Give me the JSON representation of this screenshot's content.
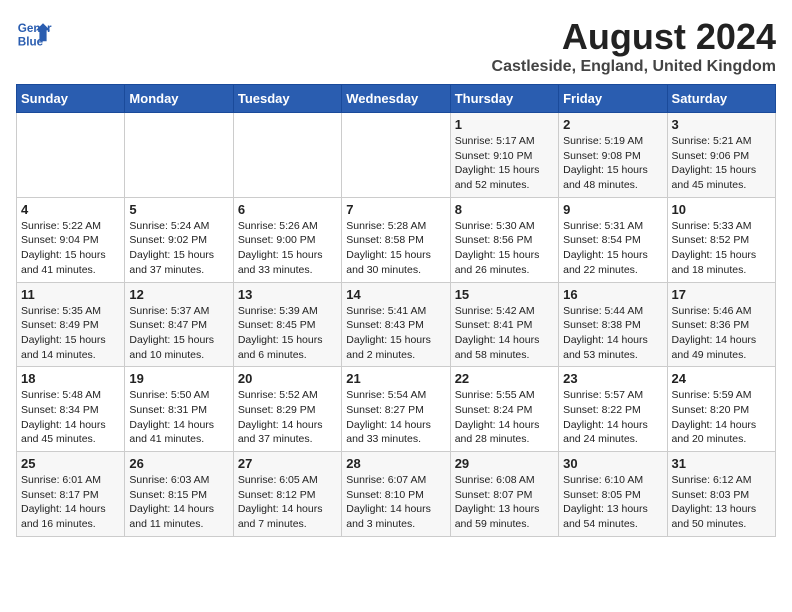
{
  "logo": {
    "line1": "General",
    "line2": "Blue"
  },
  "title": "August 2024",
  "subtitle": "Castleside, England, United Kingdom",
  "days_of_week": [
    "Sunday",
    "Monday",
    "Tuesday",
    "Wednesday",
    "Thursday",
    "Friday",
    "Saturday"
  ],
  "weeks": [
    [
      {
        "day": "",
        "info": ""
      },
      {
        "day": "",
        "info": ""
      },
      {
        "day": "",
        "info": ""
      },
      {
        "day": "",
        "info": ""
      },
      {
        "day": "1",
        "info": "Sunrise: 5:17 AM\nSunset: 9:10 PM\nDaylight: 15 hours\nand 52 minutes."
      },
      {
        "day": "2",
        "info": "Sunrise: 5:19 AM\nSunset: 9:08 PM\nDaylight: 15 hours\nand 48 minutes."
      },
      {
        "day": "3",
        "info": "Sunrise: 5:21 AM\nSunset: 9:06 PM\nDaylight: 15 hours\nand 45 minutes."
      }
    ],
    [
      {
        "day": "4",
        "info": "Sunrise: 5:22 AM\nSunset: 9:04 PM\nDaylight: 15 hours\nand 41 minutes."
      },
      {
        "day": "5",
        "info": "Sunrise: 5:24 AM\nSunset: 9:02 PM\nDaylight: 15 hours\nand 37 minutes."
      },
      {
        "day": "6",
        "info": "Sunrise: 5:26 AM\nSunset: 9:00 PM\nDaylight: 15 hours\nand 33 minutes."
      },
      {
        "day": "7",
        "info": "Sunrise: 5:28 AM\nSunset: 8:58 PM\nDaylight: 15 hours\nand 30 minutes."
      },
      {
        "day": "8",
        "info": "Sunrise: 5:30 AM\nSunset: 8:56 PM\nDaylight: 15 hours\nand 26 minutes."
      },
      {
        "day": "9",
        "info": "Sunrise: 5:31 AM\nSunset: 8:54 PM\nDaylight: 15 hours\nand 22 minutes."
      },
      {
        "day": "10",
        "info": "Sunrise: 5:33 AM\nSunset: 8:52 PM\nDaylight: 15 hours\nand 18 minutes."
      }
    ],
    [
      {
        "day": "11",
        "info": "Sunrise: 5:35 AM\nSunset: 8:49 PM\nDaylight: 15 hours\nand 14 minutes."
      },
      {
        "day": "12",
        "info": "Sunrise: 5:37 AM\nSunset: 8:47 PM\nDaylight: 15 hours\nand 10 minutes."
      },
      {
        "day": "13",
        "info": "Sunrise: 5:39 AM\nSunset: 8:45 PM\nDaylight: 15 hours\nand 6 minutes."
      },
      {
        "day": "14",
        "info": "Sunrise: 5:41 AM\nSunset: 8:43 PM\nDaylight: 15 hours\nand 2 minutes."
      },
      {
        "day": "15",
        "info": "Sunrise: 5:42 AM\nSunset: 8:41 PM\nDaylight: 14 hours\nand 58 minutes."
      },
      {
        "day": "16",
        "info": "Sunrise: 5:44 AM\nSunset: 8:38 PM\nDaylight: 14 hours\nand 53 minutes."
      },
      {
        "day": "17",
        "info": "Sunrise: 5:46 AM\nSunset: 8:36 PM\nDaylight: 14 hours\nand 49 minutes."
      }
    ],
    [
      {
        "day": "18",
        "info": "Sunrise: 5:48 AM\nSunset: 8:34 PM\nDaylight: 14 hours\nand 45 minutes."
      },
      {
        "day": "19",
        "info": "Sunrise: 5:50 AM\nSunset: 8:31 PM\nDaylight: 14 hours\nand 41 minutes."
      },
      {
        "day": "20",
        "info": "Sunrise: 5:52 AM\nSunset: 8:29 PM\nDaylight: 14 hours\nand 37 minutes."
      },
      {
        "day": "21",
        "info": "Sunrise: 5:54 AM\nSunset: 8:27 PM\nDaylight: 14 hours\nand 33 minutes."
      },
      {
        "day": "22",
        "info": "Sunrise: 5:55 AM\nSunset: 8:24 PM\nDaylight: 14 hours\nand 28 minutes."
      },
      {
        "day": "23",
        "info": "Sunrise: 5:57 AM\nSunset: 8:22 PM\nDaylight: 14 hours\nand 24 minutes."
      },
      {
        "day": "24",
        "info": "Sunrise: 5:59 AM\nSunset: 8:20 PM\nDaylight: 14 hours\nand 20 minutes."
      }
    ],
    [
      {
        "day": "25",
        "info": "Sunrise: 6:01 AM\nSunset: 8:17 PM\nDaylight: 14 hours\nand 16 minutes."
      },
      {
        "day": "26",
        "info": "Sunrise: 6:03 AM\nSunset: 8:15 PM\nDaylight: 14 hours\nand 11 minutes."
      },
      {
        "day": "27",
        "info": "Sunrise: 6:05 AM\nSunset: 8:12 PM\nDaylight: 14 hours\nand 7 minutes."
      },
      {
        "day": "28",
        "info": "Sunrise: 6:07 AM\nSunset: 8:10 PM\nDaylight: 14 hours\nand 3 minutes."
      },
      {
        "day": "29",
        "info": "Sunrise: 6:08 AM\nSunset: 8:07 PM\nDaylight: 13 hours\nand 59 minutes."
      },
      {
        "day": "30",
        "info": "Sunrise: 6:10 AM\nSunset: 8:05 PM\nDaylight: 13 hours\nand 54 minutes."
      },
      {
        "day": "31",
        "info": "Sunrise: 6:12 AM\nSunset: 8:03 PM\nDaylight: 13 hours\nand 50 minutes."
      }
    ]
  ]
}
